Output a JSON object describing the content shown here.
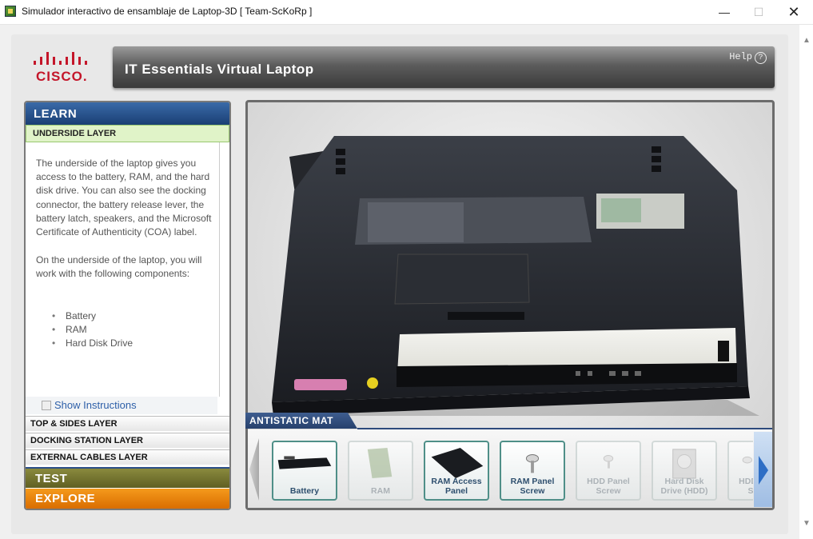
{
  "window": {
    "title": "Simulador interactivo de ensamblaje de Laptop-3D [ Team-ScKoRp ]",
    "minimize": "—",
    "maximize": "☐",
    "close": "✕"
  },
  "header": {
    "logo_text": "CISCO.",
    "title": "IT Essentials Virtual Laptop",
    "help_label": "Help",
    "help_icon": "?"
  },
  "sidebar": {
    "learn": "LEARN",
    "current_layer": "UNDERSIDE LAYER",
    "paragraph1": "The underside of the laptop gives you access to the battery, RAM, and the hard disk drive. You can also see the docking connector, the battery release lever, the battery latch, speakers, and the Microsoft Certificate of Authenticity (COA) label.",
    "paragraph2": "On the underside of the laptop, you will work with the following components:",
    "components": [
      "Battery",
      "RAM",
      "Hard Disk Drive"
    ],
    "show_instructions": "Show Instructions",
    "layers": [
      "TOP & SIDES LAYER",
      "DOCKING STATION LAYER",
      "EXTERNAL CABLES LAYER"
    ],
    "test": "TEST",
    "explore": "EXPLORE"
  },
  "mat": {
    "label": "ANTISTATIC MAT",
    "items": [
      {
        "label": "Battery",
        "icon": "battery-icon",
        "enabled": true
      },
      {
        "label": "RAM",
        "icon": "ram-icon",
        "enabled": false
      },
      {
        "label": "RAM Access Panel",
        "icon": "ram-access-panel-icon",
        "enabled": true
      },
      {
        "label": "RAM Panel Screw",
        "icon": "screw-icon",
        "enabled": true
      },
      {
        "label": "HDD Panel Screw",
        "icon": "screw-icon",
        "enabled": false
      },
      {
        "label": "Hard Disk Drive (HDD)",
        "icon": "hdd-icon",
        "enabled": false
      },
      {
        "label": "HDD Panel Screw",
        "icon": "screw-icon",
        "enabled": false
      }
    ]
  },
  "colors": {
    "learn": "#1a3f74",
    "test": "#6f6f2a",
    "explore": "#e8830d",
    "accent_text": "#2d5fa8",
    "cisco_red": "#c4162a"
  }
}
